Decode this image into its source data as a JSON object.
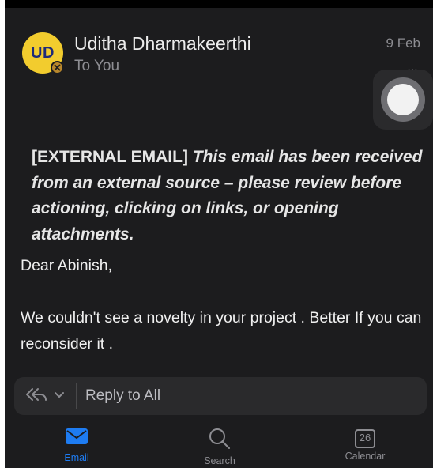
{
  "message": {
    "avatar_initials": "UD",
    "sender_name": "Uditha Dharmakeerthi",
    "recipient": "To You",
    "date": "9 Feb",
    "more_icon": "…",
    "warning_tag": "[EXTERNAL EMAIL]",
    "warning_text": "This email has been received from an external source – please review before actioning, clicking on links, or opening attachments.",
    "greeting": "Dear Abinish,",
    "body": " We couldn't see a novelty in your project . Better If you can reconsider it ."
  },
  "reply_bar": {
    "label": "Reply to All",
    "icons": [
      "reply-all-icon",
      "chevron-down-icon"
    ]
  },
  "tabs": [
    {
      "label": "Email",
      "icon": "envelope-icon",
      "active": true
    },
    {
      "label": "Search",
      "icon": "search-icon",
      "active": false
    },
    {
      "label": "Calendar",
      "icon": "calendar-icon",
      "calendar_day": "26",
      "active": false
    }
  ],
  "colors": {
    "background": "#1c1c1e",
    "avatar": "#f2cc2e",
    "accent": "#1e7cf2"
  }
}
